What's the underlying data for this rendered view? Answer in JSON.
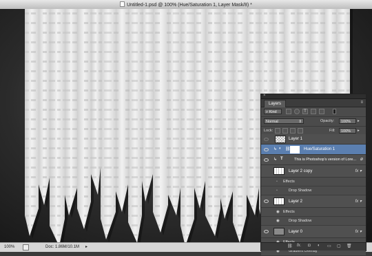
{
  "window": {
    "title": "Untitled-1.psd @ 100% (Hue/Saturation 1, Layer Mask/8) *"
  },
  "status": {
    "zoom": "100%",
    "doc": "Doc: 1.86M/10.1M"
  },
  "layers_panel": {
    "tab_label": "Layers",
    "kind_label": "Kind",
    "blend_mode": "Normal",
    "opacity_label": "Opacity:",
    "opacity_value": "100%",
    "lock_label": "Lock:",
    "fill_label": "Fill:",
    "fill_value": "100%",
    "layers": [
      {
        "name": "Layer 1"
      },
      {
        "name": "Hue/Saturation 1"
      },
      {
        "name": "This is Photoshop's version  of Lore..."
      },
      {
        "name": "Layer 2 copy",
        "effects_label": "Effects",
        "effect": "Drop Shadow"
      },
      {
        "name": "Layer 2",
        "effects_label": "Effects",
        "effect": "Drop Shadow"
      },
      {
        "name": "Layer 0",
        "effects_label": "Effects",
        "effect": "Gradient Overlay"
      }
    ]
  },
  "colors": {
    "paper": "#e9e9e9",
    "background": "#2b2b2b",
    "selection": "#5b7fb0"
  }
}
